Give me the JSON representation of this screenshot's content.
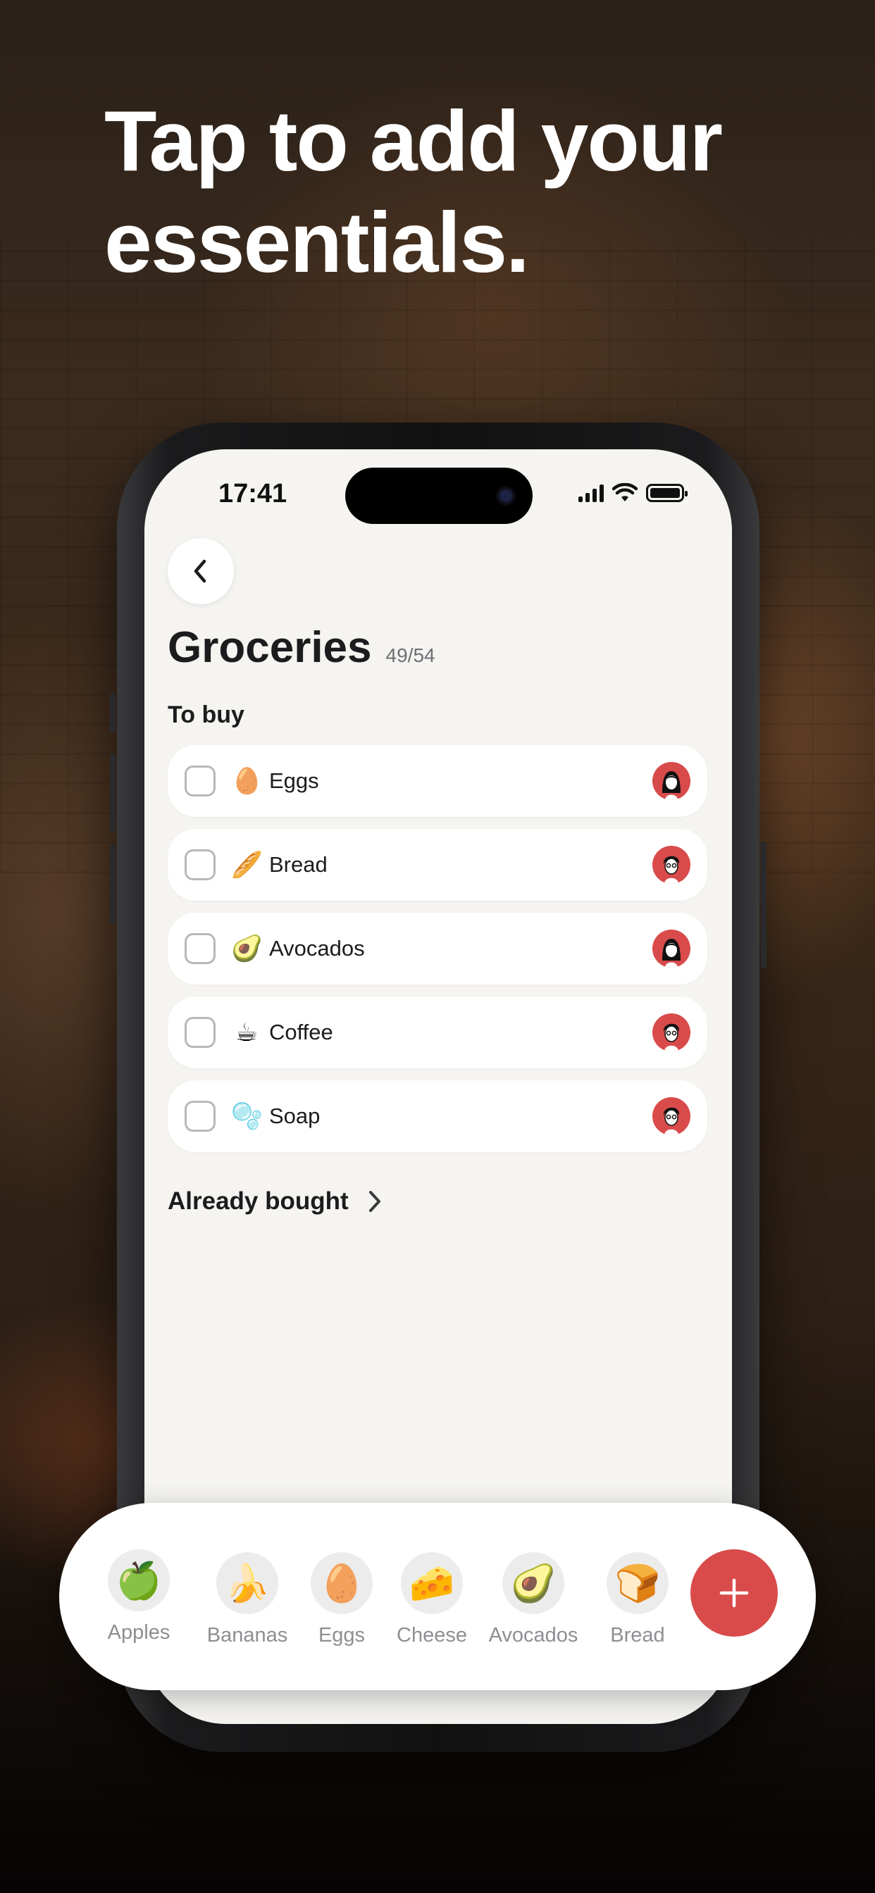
{
  "headline": "Tap to add your essentials.",
  "status_bar": {
    "time": "17:41"
  },
  "list": {
    "title": "Groceries",
    "count": "49/54",
    "section_to_buy": "To buy",
    "items": [
      {
        "emoji": "🥚",
        "name": "Eggs"
      },
      {
        "emoji": "🥖",
        "name": "Bread"
      },
      {
        "emoji": "🥑",
        "name": "Avocados"
      },
      {
        "emoji": "☕",
        "name": "Coffee"
      },
      {
        "emoji": "🫧",
        "name": "Soap"
      }
    ],
    "already_bought": "Already bought"
  },
  "suggestions": [
    {
      "emoji": "🍏",
      "label": "Apples"
    },
    {
      "emoji": "🍌",
      "label": "Bananas"
    },
    {
      "emoji": "🥚",
      "label": "Eggs"
    },
    {
      "emoji": "🧀",
      "label": "Cheese"
    },
    {
      "emoji": "🥑",
      "label": "Avocados"
    },
    {
      "emoji": "🍞",
      "label": "Bread"
    }
  ],
  "icons": {
    "back": "chevron-left-icon",
    "already_bought": "chevron-right-icon",
    "add": "plus-icon",
    "signal": "cellular-signal-icon",
    "wifi": "wifi-icon",
    "battery": "battery-icon",
    "avatar": "user-avatar"
  },
  "colors": {
    "accent": "#d94b4b",
    "screen_background": "#f5f4f1",
    "card": "#ffffff",
    "text": "#1c1c1e",
    "muted": "#8e8e93"
  }
}
